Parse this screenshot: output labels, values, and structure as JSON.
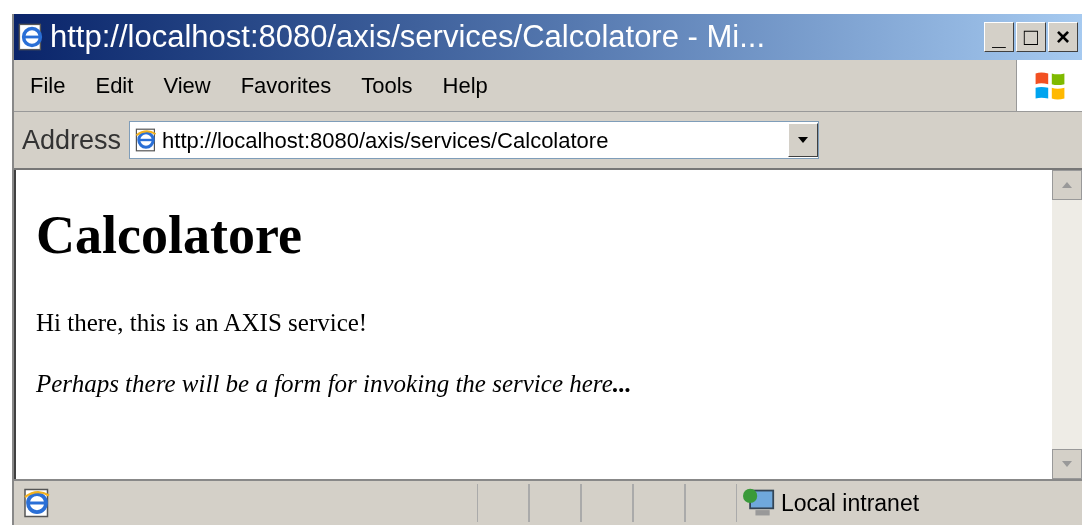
{
  "window": {
    "title": "http://localhost:8080/axis/services/Calcolatore - Mi...",
    "controls": [
      "_",
      "□",
      "×"
    ]
  },
  "menu": [
    "File",
    "Edit",
    "View",
    "Favorites",
    "Tools",
    "Help"
  ],
  "address": {
    "label": "Address",
    "value": "http://localhost:8080/axis/services/Calcolatore"
  },
  "page": {
    "heading": "Calcolatore",
    "paragraphs": [
      {
        "text": "Hi there, this is an AXIS service!",
        "italic": false
      },
      {
        "text": "Perhaps there will be a form for invoking the service here**...**",
        "italic": true
      }
    ]
  },
  "status_bar": {
    "zone": "Local intranet"
  }
}
